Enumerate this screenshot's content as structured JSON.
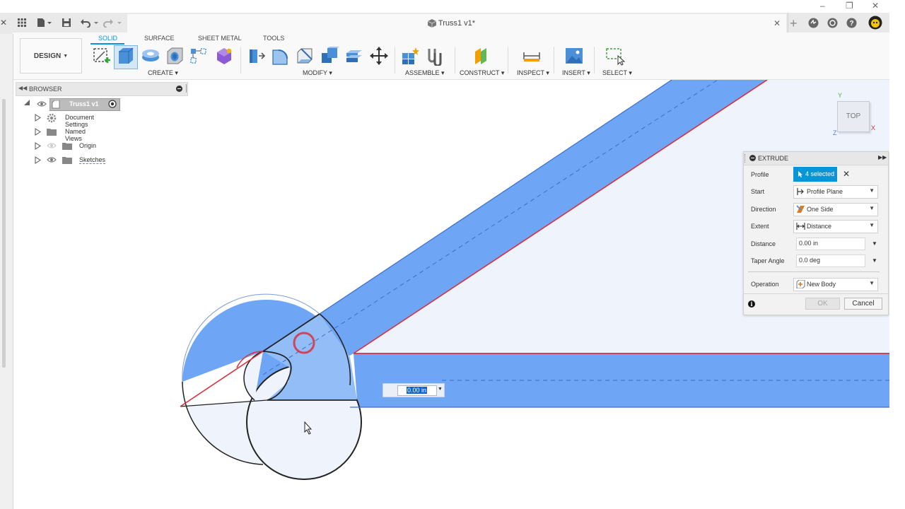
{
  "tab": {
    "title": "Truss1 v1*"
  },
  "toolbar": {
    "workspace": "DESIGN",
    "tabs": [
      "SOLID",
      "SURFACE",
      "SHEET METAL",
      "TOOLS"
    ],
    "groups": {
      "create": "CREATE",
      "modify": "MODIFY",
      "assemble": "ASSEMBLE",
      "construct": "CONSTRUCT",
      "inspect": "INSPECT",
      "insert": "INSERT",
      "select": "SELECT"
    }
  },
  "browser": {
    "title": "BROWSER",
    "root": "Truss1 v1",
    "items": [
      "Document Settings",
      "Named Views",
      "Origin",
      "Sketches"
    ]
  },
  "viewcube": {
    "face": "TOP",
    "axis_x": "X",
    "axis_y": "Y",
    "axis_z": "Z"
  },
  "canvas": {
    "distance_input": "0.00 in"
  },
  "extrude": {
    "title": "EXTRUDE",
    "profile_label": "Profile",
    "profile_value": "4 selected",
    "start_label": "Start",
    "start_value": "Profile Plane",
    "direction_label": "Direction",
    "direction_value": "One Side",
    "extent_label": "Extent",
    "extent_value": "Distance",
    "distance_label": "Distance",
    "distance_value": "0.00 in",
    "taper_label": "Taper Angle",
    "taper_value": "0.0 deg",
    "operation_label": "Operation",
    "operation_value": "New Body",
    "ok": "OK",
    "cancel": "Cancel"
  },
  "colors": {
    "accent": "#0696d7",
    "body_blue": "#6ea6f5",
    "light_fill": "#eef3fc",
    "edge_red": "#d9303e"
  }
}
